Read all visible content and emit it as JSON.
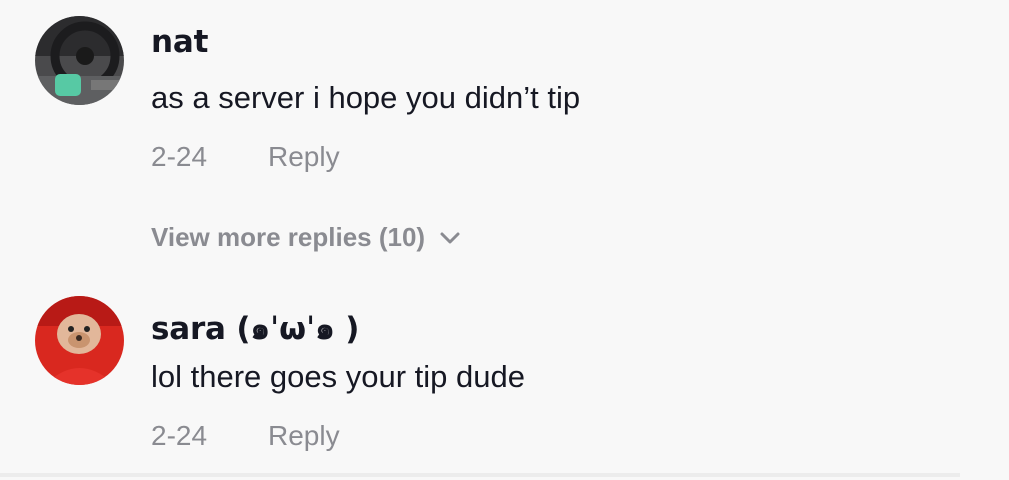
{
  "comments": [
    {
      "username": "nat",
      "text": "as a server i hope you didn’t tip",
      "date": "2-24",
      "reply_label": "Reply",
      "avatar_icon": "avatar-car-interior"
    },
    {
      "username": "sara (๑ˈωˈ๑ )",
      "text": "lol there goes your tip dude",
      "date": "2-24",
      "reply_label": "Reply",
      "avatar_icon": "avatar-dog-red-hoodie"
    }
  ],
  "view_more": {
    "label": "View more replies (10)",
    "icon": "chevron-down-icon"
  },
  "colors": {
    "background": "#f8f8f8",
    "primary_text": "#161823",
    "secondary_text": "#8a8b91"
  }
}
